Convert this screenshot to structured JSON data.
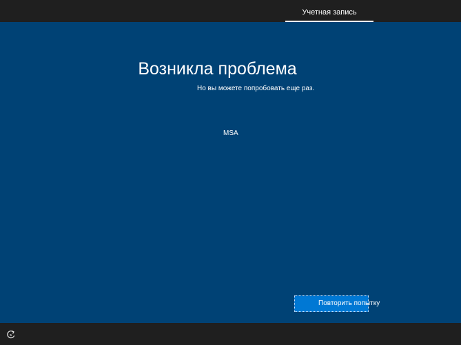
{
  "top_bar": {
    "tab_label": "Учетная запись"
  },
  "main": {
    "title": "Возникла проблема",
    "subtitle": "Но вы можете попробовать еще раз.",
    "error_code": "MSA",
    "retry_label": "Повторить попытку"
  },
  "bottom_bar": {
    "icon": "ease-of-access-icon"
  },
  "colors": {
    "background": "#004275",
    "bars": "#1f1f1f",
    "accent": "#0078d4",
    "text": "#ffffff"
  }
}
